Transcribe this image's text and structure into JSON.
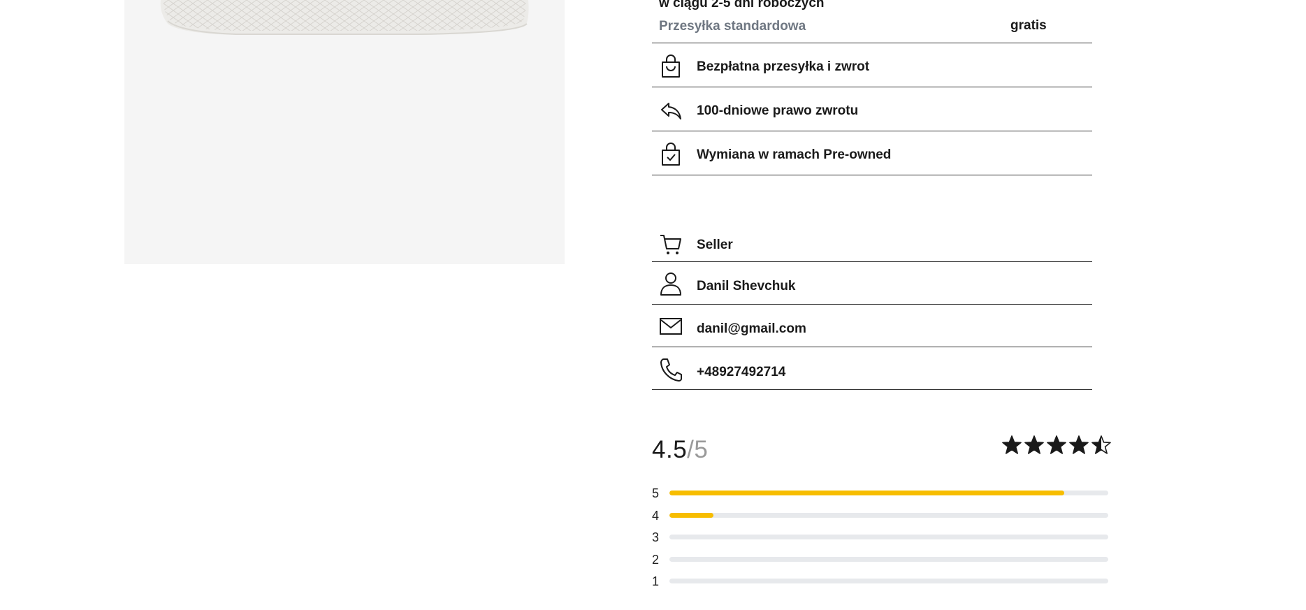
{
  "product": {
    "image_alt": "white mesh sneaker sole"
  },
  "delivery": {
    "time_text": "w ciągu 2-5 dni roboczych",
    "shipping_name": "Przesyłka standardowa",
    "shipping_price": "gratis"
  },
  "benefits": [
    {
      "icon": "shopping-bag-icon",
      "label": "Bezpłatna przesyłka i zwrot"
    },
    {
      "icon": "return-arrow-icon",
      "label": "100-dniowe prawo zwrotu"
    },
    {
      "icon": "bag-check-icon",
      "label": "Wymiana w ramach Pre-owned"
    }
  ],
  "seller": [
    {
      "icon": "cart-icon",
      "label": "Seller"
    },
    {
      "icon": "user-icon",
      "label": "Danil Shevchuk"
    },
    {
      "icon": "mail-icon",
      "label": "danil@gmail.com"
    },
    {
      "icon": "phone-icon",
      "label": "+48927492714"
    }
  ],
  "rating": {
    "score": "4.5",
    "out_of": "/5",
    "stars": 4.5,
    "accent_color": "#f7bd00",
    "track_color": "#e7e9ec",
    "distribution": [
      {
        "stars": "5",
        "fraction": 0.9
      },
      {
        "stars": "4",
        "fraction": 0.1
      },
      {
        "stars": "3",
        "fraction": 0
      },
      {
        "stars": "2",
        "fraction": 0
      },
      {
        "stars": "1",
        "fraction": 0
      }
    ]
  }
}
